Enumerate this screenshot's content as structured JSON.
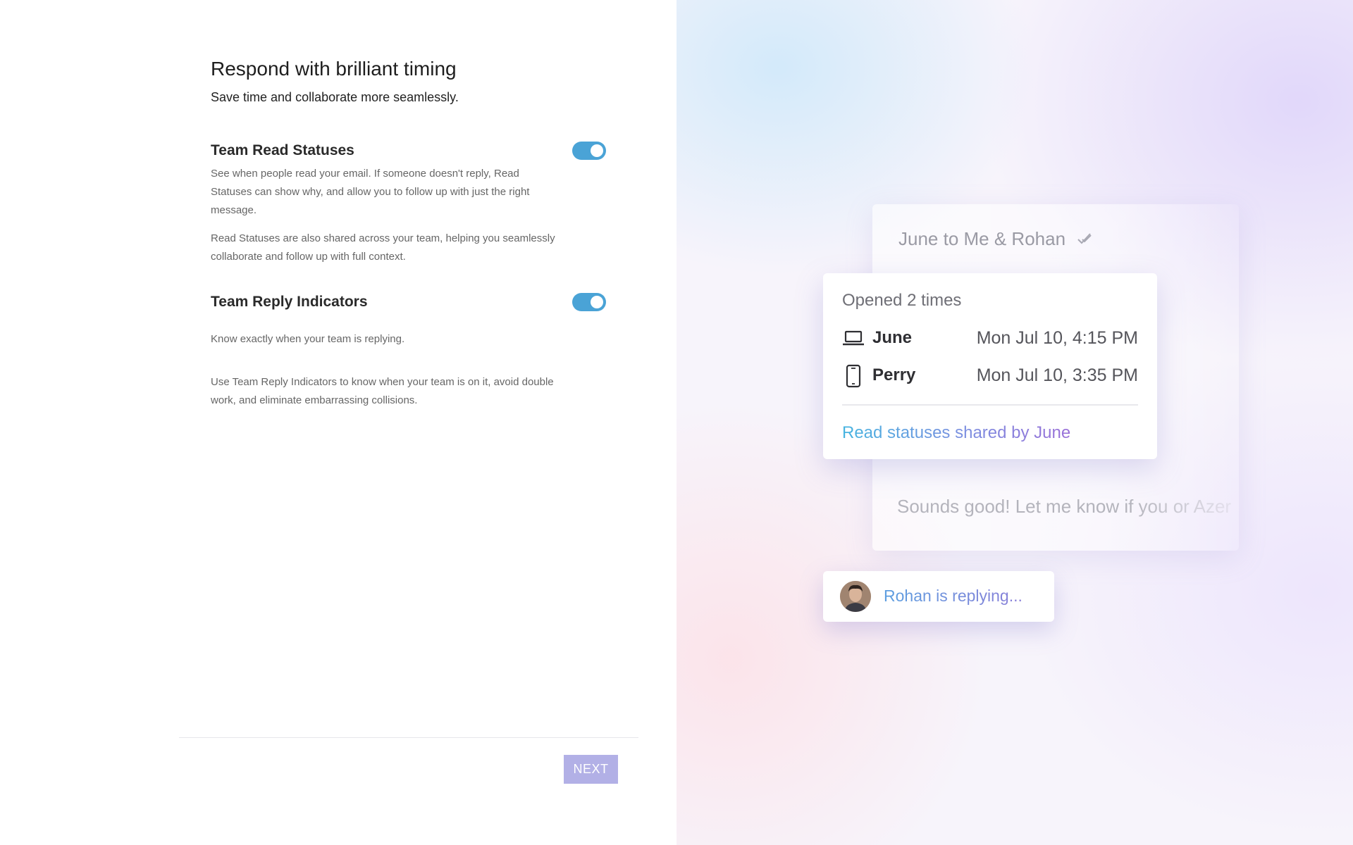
{
  "onboarding": {
    "title": "Respond with brilliant timing",
    "subtitle": "Save time and collaborate more seamlessly.",
    "settings": [
      {
        "label": "Team Read Statuses",
        "enabled": true,
        "descriptions": [
          "See when people read your email. If someone doesn't reply, Read Statuses can show why, and allow you to follow up with just the right message.",
          "Read Statuses are also shared across your team, helping you seamlessly collaborate and follow up with full context."
        ]
      },
      {
        "label": "Team Reply Indicators",
        "enabled": true,
        "descriptions": [
          "Know exactly when your team is replying.",
          "Use Team Reply Indicators to know when your team is on it, avoid double work, and eliminate embarrassing collisions."
        ]
      }
    ],
    "next_label": "NEXT"
  },
  "preview": {
    "thread_header": "June to Me & Rohan",
    "read_popup": {
      "title": "Opened 2 times",
      "reads": [
        {
          "name": "June",
          "device_icon": "laptop-icon",
          "time": "Mon Jul 10, 4:15 PM"
        },
        {
          "name": "Perry",
          "device_icon": "phone-icon",
          "time": "Mon Jul 10, 3:35 PM"
        }
      ],
      "shared_by": "Read statuses shared by June"
    },
    "reply_preview": "Sounds good! Let me know if you or Azer",
    "replying": "Rohan is replying..."
  },
  "colors": {
    "toggle_on": "#4aa3d6",
    "next_button": "#b2b0e6",
    "link_gradient_start": "#46b4e0",
    "link_gradient_end": "#9a70d8"
  }
}
